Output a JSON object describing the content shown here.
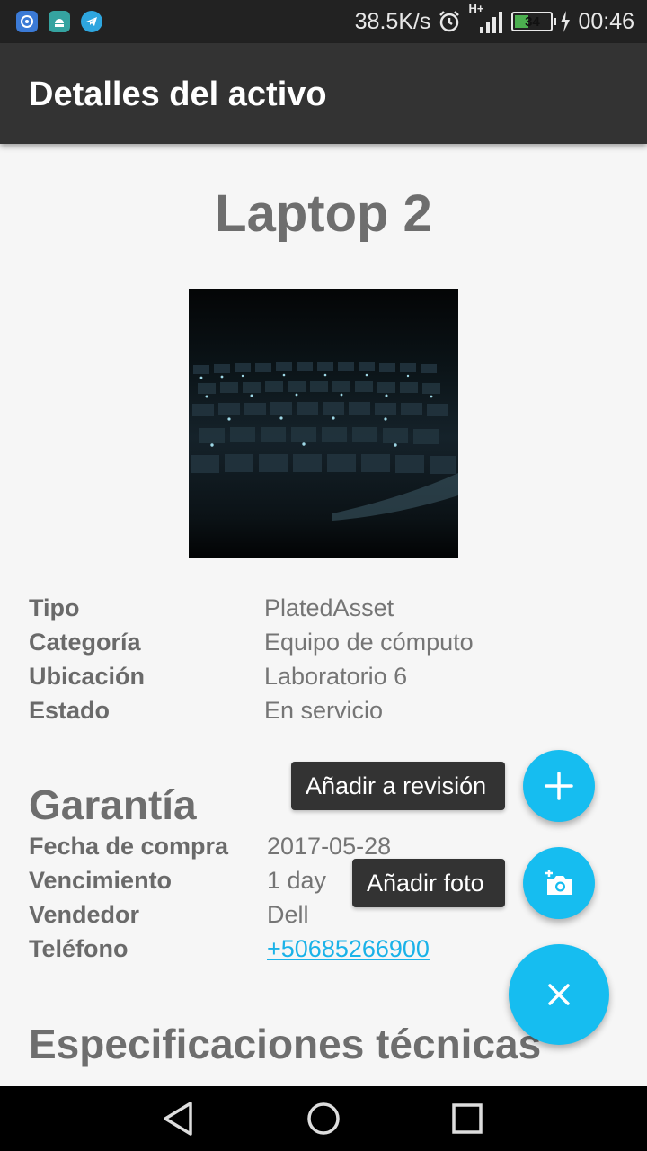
{
  "status_bar": {
    "net_speed": "38.5K/s",
    "network_label": "H+",
    "battery": "34",
    "time": "00:46",
    "icons": [
      "app-notification-icon",
      "android-icon",
      "telegram-icon",
      "alarm-icon",
      "signal-icon",
      "battery-icon",
      "charging-icon"
    ]
  },
  "app_bar": {
    "title": "Detalles del activo"
  },
  "asset": {
    "name": "Laptop 2",
    "details": [
      {
        "label": "Tipo",
        "value": "PlatedAsset"
      },
      {
        "label": "Categoría",
        "value": "Equipo de cómputo"
      },
      {
        "label": "Ubicación",
        "value": "Laboratorio 6"
      },
      {
        "label": "Estado",
        "value": "En servicio"
      }
    ]
  },
  "warranty": {
    "title": "Garantía",
    "details": [
      {
        "label": "Fecha de compra",
        "value": "2017-05-28"
      },
      {
        "label": "Vencimiento",
        "value": "1 day"
      },
      {
        "label": "Vendedor",
        "value": "Dell"
      },
      {
        "label": "Teléfono",
        "value": "+50685266900"
      }
    ]
  },
  "specs": {
    "title": "Especificaciones técnicas"
  },
  "fab_menu": {
    "add_review_label": "Añadir a revisión",
    "add_photo_label": "Añadir foto",
    "accent_color": "#16bdf0"
  },
  "nav_bar": {
    "icons": [
      "back-icon",
      "home-icon",
      "recents-icon"
    ]
  }
}
